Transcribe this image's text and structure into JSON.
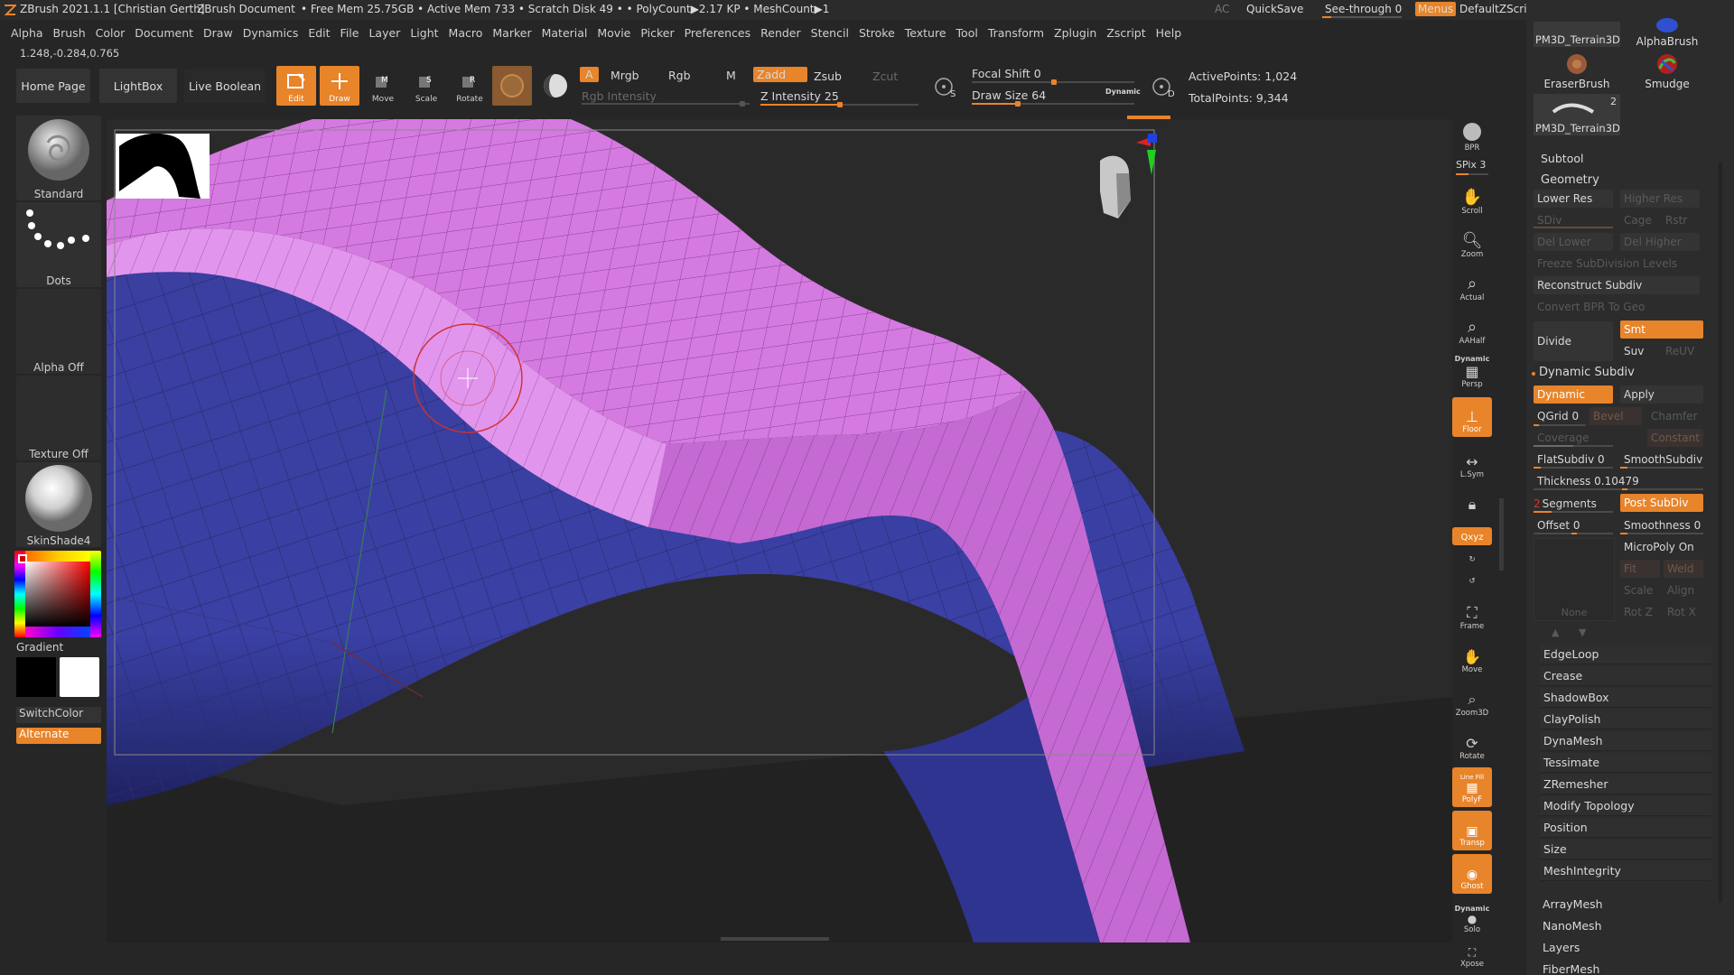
{
  "titlebar": {
    "app": "ZBrush 2021.1.1 [Christian Gerth]",
    "doc": "ZBrush Document",
    "status": "• Free Mem 25.75GB • Active Mem 733 • Scratch Disk 49 •  • PolyCount▶2.17 KP  • MeshCount▶1",
    "ac": "AC",
    "quicksave": "QuickSave",
    "seethrough": "See-through  0",
    "menus": "Menus",
    "script": "DefaultZScript"
  },
  "menu": [
    "Alpha",
    "Brush",
    "Color",
    "Document",
    "Draw",
    "Dynamics",
    "Edit",
    "File",
    "Layer",
    "Light",
    "Macro",
    "Marker",
    "Material",
    "Movie",
    "Picker",
    "Preferences",
    "Render",
    "Stencil",
    "Stroke",
    "Texture",
    "Tool",
    "Transform",
    "Zplugin",
    "Zscript",
    "Help"
  ],
  "coords": "1.248,-0.284,0.765",
  "shelf": {
    "home": "Home Page",
    "lightbox": "LightBox",
    "liveboolean": "Live Boolean",
    "edit": "Edit",
    "draw": "Draw",
    "move": "Move",
    "scale": "Scale",
    "rotate": "Rotate",
    "a": "A",
    "mrgb": "Mrgb",
    "rgb": "Rgb",
    "m": "M",
    "rgb_intensity": "Rgb Intensity",
    "zadd": "Zadd",
    "zsub": "Zsub",
    "zcut": "Zcut",
    "z_intensity": "Z Intensity 25",
    "focal_shift": "Focal Shift 0",
    "draw_size": "Draw Size 64",
    "dynamic": "Dynamic",
    "s_label": "S",
    "d_label": "D",
    "active_points": "ActivePoints: 1,024",
    "total_points": "TotalPoints: 9,344"
  },
  "left": {
    "standard": "Standard",
    "dots": "Dots",
    "alpha_off": "Alpha Off",
    "texture_off": "Texture Off",
    "material": "SkinShade4",
    "gradient": "Gradient",
    "switchcolor": "SwitchColor",
    "alternate": "Alternate"
  },
  "rightshelf": {
    "bpr": "BPR",
    "spix": "SPix 3",
    "scroll": "Scroll",
    "zoom": "Zoom",
    "actual": "Actual",
    "aahalf": "AAHalf",
    "dynamic_persp_top": "Dynamic",
    "persp": "Persp",
    "floor": "Floor",
    "lsym": "L.Sym",
    "xyz": "Qxyz",
    "frame": "Frame",
    "move": "Move",
    "zoom3d": "Zoom3D",
    "rotate": "Rotate",
    "linefill": "Line Fill",
    "polyf": "PolyF",
    "transp": "Transp",
    "ghost": "Ghost",
    "dynamic_solo": "Dynamic",
    "solo": "Solo",
    "xpose": "Xpose"
  },
  "palette": {
    "brush1": "PM3D_Terrain3D",
    "brush2": "AlphaBrush",
    "brush3": "EraserBrush",
    "brush4": "Smudge",
    "brush5": "PM3D_Terrain3D",
    "brush5_count": "2",
    "subtool": "Subtool",
    "geometry": "Geometry",
    "lower_res": "Lower Res",
    "higher_res": "Higher Res",
    "sdiv": "SDiv",
    "cage": "Cage",
    "rstr": "Rstr",
    "del_lower": "Del Lower",
    "del_higher": "Del Higher",
    "freeze": "Freeze SubDivision Levels",
    "reconstruct": "Reconstruct Subdiv",
    "convert_bpr": "Convert BPR To Geo",
    "divide": "Divide",
    "smt": "Smt",
    "suv": "Suv",
    "reuv": "ReUV",
    "dynamic_subdiv": "Dynamic Subdiv",
    "dynamic": "Dynamic",
    "apply": "Apply",
    "qgrid": "QGrid 0",
    "bevel": "Bevel",
    "chamfer": "Chamfer",
    "coverage": "Coverage",
    "constant": "Constant",
    "flatsubdiv": "FlatSubdiv 0",
    "smoothsubdiv": "SmoothSubdiv",
    "thickness": "Thickness 0.10479",
    "segments_num": "2",
    "segments": "Segments",
    "post_subdiv": "Post SubDiv",
    "offset": "Offset 0",
    "smoothness": "Smoothness 0",
    "micropoly": "MicroPoly On",
    "fit": "Fit",
    "weld": "Weld",
    "scale": "Scale",
    "align": "Align",
    "none": "None",
    "rotz": "Rot Z",
    "rotx": "Rot X",
    "sections": [
      "EdgeLoop",
      "Crease",
      "ShadowBox",
      "ClayPolish",
      "DynaMesh",
      "Tessimate",
      "ZRemesher",
      "Modify Topology",
      "Position",
      "Size",
      "MeshIntegrity"
    ],
    "tail": [
      "ArrayMesh",
      "NanoMesh",
      "Layers",
      "FiberMesh"
    ]
  },
  "colors": {
    "accent": "#e8842a",
    "mesh_pink": "#d47ae0",
    "mesh_blue": "#3e44a8"
  }
}
